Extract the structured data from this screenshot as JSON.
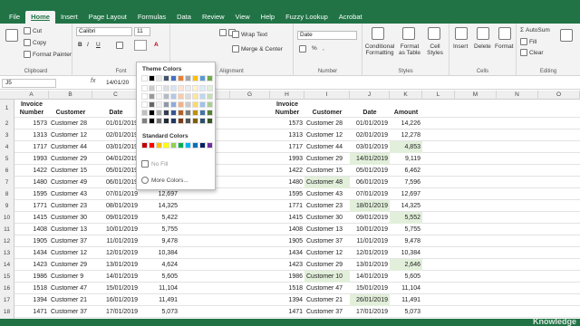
{
  "titlebar": {
    "color": "#217346"
  },
  "tabs": [
    "File",
    "Home",
    "Insert",
    "Page Layout",
    "Formulas",
    "Data",
    "Review",
    "View",
    "Help",
    "Fuzzy Lookup",
    "Acrobat"
  ],
  "active_tab": "Home",
  "ribbon": {
    "clipboard": {
      "cut": "Cut",
      "copy": "Copy",
      "format_painter": "Format Painter",
      "label": "Clipboard"
    },
    "font": {
      "name": "Calibri",
      "size": "11",
      "label": "Font"
    },
    "alignment": {
      "wrap": "Wrap Text",
      "merge": "Merge & Center",
      "label": "Alignment"
    },
    "number": {
      "format": "Date",
      "label": "Number"
    },
    "styles": {
      "conditional": "Conditional Formatting",
      "format_table": "Format as Table",
      "cell_styles": "Cell Styles",
      "label": "Styles"
    },
    "cells": {
      "insert": "Insert",
      "delete": "Delete",
      "format": "Format",
      "label": "Cells"
    },
    "editing": {
      "autosum": "AutoSum",
      "fill": "Fill",
      "clear": "Clear",
      "sort": "Sort & Filter",
      "label": "Editing"
    }
  },
  "formula_bar": {
    "name_box": "J5",
    "value": "14/01/20"
  },
  "columns_left": [
    "A",
    "B",
    "C"
  ],
  "columns_right": [
    "H",
    "I",
    "J",
    "K",
    "L",
    "M",
    "N",
    "O"
  ],
  "extra_cols": [
    "F",
    "G"
  ],
  "header_left": {
    "num_top": "Invoice",
    "num_bottom": "Number",
    "customer": "Customer",
    "date": "Date"
  },
  "header_right": {
    "num_top": "Invoice",
    "num_bottom": "Number",
    "customer": "Customer",
    "date": "Date",
    "amount": "Amount"
  },
  "left_rows": [
    [
      "1573",
      "Customer 28",
      "01/01/2019",
      ""
    ],
    [
      "1313",
      "Customer 12",
      "02/01/2019",
      ""
    ],
    [
      "1717",
      "Customer 44",
      "03/01/2019",
      ""
    ],
    [
      "1993",
      "Customer 29",
      "04/01/2019",
      ""
    ],
    [
      "1422",
      "Customer 15",
      "05/01/2019",
      ""
    ],
    [
      "1480",
      "Customer 49",
      "06/01/2019",
      ""
    ],
    [
      "1595",
      "Customer 43",
      "07/01/2019",
      "12,697"
    ],
    [
      "1771",
      "Customer 23",
      "08/01/2019",
      "14,325"
    ],
    [
      "1415",
      "Customer 30",
      "09/01/2019",
      "5,422"
    ],
    [
      "1408",
      "Customer 13",
      "10/01/2019",
      "5,755"
    ],
    [
      "1905",
      "Customer 37",
      "11/01/2019",
      "9,478"
    ],
    [
      "1434",
      "Customer 12",
      "12/01/2019",
      "10,384"
    ],
    [
      "1423",
      "Customer 29",
      "13/01/2019",
      "4,624"
    ],
    [
      "1986",
      "Customer 9",
      "14/01/2019",
      "5,605"
    ],
    [
      "1518",
      "Customer 47",
      "15/01/2019",
      "11,104"
    ],
    [
      "1394",
      "Customer 21",
      "16/01/2019",
      "11,491"
    ],
    [
      "1471",
      "Customer 37",
      "17/01/2019",
      "5,073"
    ],
    [
      "1309",
      "Customer 24",
      "18/01/2019",
      "5,791"
    ]
  ],
  "right_rows": [
    [
      "1573",
      "Customer 28",
      "01/01/2019",
      "14,226"
    ],
    [
      "1313",
      "Customer 12",
      "02/01/2019",
      "12,278"
    ],
    [
      "1717",
      "Customer 44",
      "03/01/2019",
      "4,853"
    ],
    [
      "1993",
      "Customer 29",
      "14/01/2019",
      "9,119"
    ],
    [
      "1422",
      "Customer 15",
      "05/01/2019",
      "6,462"
    ],
    [
      "1480",
      "Customer 48",
      "06/01/2019",
      "7,596"
    ],
    [
      "1595",
      "Customer 43",
      "07/01/2019",
      "12,697"
    ],
    [
      "1771",
      "Customer 23",
      "18/01/2019",
      "14,325"
    ],
    [
      "1415",
      "Customer 30",
      "09/01/2019",
      "5,552"
    ],
    [
      "1408",
      "Customer 13",
      "10/01/2019",
      "5,755"
    ],
    [
      "1905",
      "Customer 37",
      "11/01/2019",
      "9,478"
    ],
    [
      "1434",
      "Customer 12",
      "12/01/2019",
      "10,384"
    ],
    [
      "1423",
      "Customer 29",
      "13/01/2019",
      "2,646"
    ],
    [
      "1986",
      "Customer 10",
      "14/01/2019",
      "5,605"
    ],
    [
      "1518",
      "Customer 47",
      "15/01/2019",
      "11,104"
    ],
    [
      "1394",
      "Customer 21",
      "26/01/2019",
      "11,491"
    ],
    [
      "1471",
      "Customer 37",
      "17/01/2019",
      "5,073"
    ],
    [
      "1309",
      "Customer 24",
      "18/01/2019",
      "5,791"
    ]
  ],
  "highlights": {
    "amount_rows": [
      2,
      8,
      12
    ],
    "date_rows": [
      3,
      7,
      15
    ],
    "customer_rows": [
      5,
      13
    ]
  },
  "highlight_color": "#e2efda",
  "popup": {
    "theme_title": "Theme Colors",
    "standard_title": "Standard Colors",
    "no_fill": "No Fill",
    "more_colors": "More Colors...",
    "theme_top": [
      "#ffffff",
      "#000000",
      "#e7e6e6",
      "#44546a",
      "#4472c4",
      "#ed7d31",
      "#a5a5a5",
      "#ffc000",
      "#5b9bd5",
      "#70ad47"
    ],
    "standard": [
      "#c00000",
      "#ff0000",
      "#ffc000",
      "#ffff00",
      "#92d050",
      "#00b050",
      "#00b0f0",
      "#0070c0",
      "#002060",
      "#7030a0"
    ]
  },
  "watermark": "Knowledge"
}
